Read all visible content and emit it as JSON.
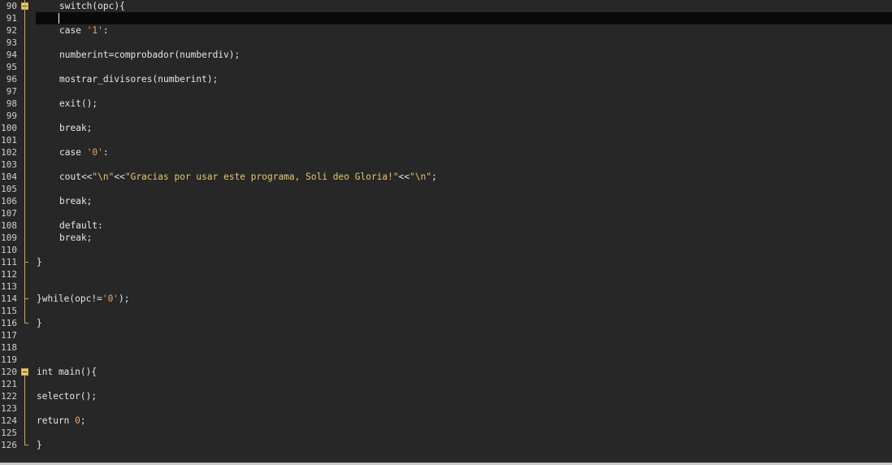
{
  "editor": {
    "lines": [
      {
        "n": "90",
        "indent": 2,
        "tokens": [
          [
            "plain",
            "switch(opc){"
          ]
        ]
      },
      {
        "n": "91",
        "indent": 2,
        "tokens": []
      },
      {
        "n": "92",
        "indent": 2,
        "tokens": [
          [
            "plain",
            "case "
          ],
          [
            "num",
            "'1'"
          ],
          [
            "plain",
            ":"
          ]
        ]
      },
      {
        "n": "93",
        "indent": 2,
        "tokens": []
      },
      {
        "n": "94",
        "indent": 2,
        "tokens": [
          [
            "plain",
            "numberint=comprobador(numberdiv);"
          ]
        ]
      },
      {
        "n": "95",
        "indent": 2,
        "tokens": []
      },
      {
        "n": "96",
        "indent": 2,
        "tokens": [
          [
            "plain",
            "mostrar_divisores(numberint);"
          ]
        ]
      },
      {
        "n": "97",
        "indent": 2,
        "tokens": []
      },
      {
        "n": "98",
        "indent": 2,
        "tokens": [
          [
            "plain",
            "exit();"
          ]
        ]
      },
      {
        "n": "99",
        "indent": 2,
        "tokens": []
      },
      {
        "n": "100",
        "indent": 2,
        "tokens": [
          [
            "plain",
            "break;"
          ]
        ]
      },
      {
        "n": "101",
        "indent": 2,
        "tokens": []
      },
      {
        "n": "102",
        "indent": 2,
        "tokens": [
          [
            "plain",
            "case "
          ],
          [
            "num",
            "'0'"
          ],
          [
            "plain",
            ":"
          ]
        ]
      },
      {
        "n": "103",
        "indent": 2,
        "tokens": []
      },
      {
        "n": "104",
        "indent": 2,
        "tokens": [
          [
            "plain",
            "cout<<"
          ],
          [
            "str",
            "\"\\n\""
          ],
          [
            "plain",
            "<<"
          ],
          [
            "str",
            "\"Gracias por usar este programa, Soli deo Gloria!\""
          ],
          [
            "plain",
            "<<"
          ],
          [
            "str",
            "\"\\n\""
          ],
          [
            "plain",
            ";"
          ]
        ]
      },
      {
        "n": "105",
        "indent": 2,
        "tokens": []
      },
      {
        "n": "106",
        "indent": 2,
        "tokens": [
          [
            "plain",
            "break;"
          ]
        ]
      },
      {
        "n": "107",
        "indent": 2,
        "tokens": []
      },
      {
        "n": "108",
        "indent": 2,
        "tokens": [
          [
            "plain",
            "default:"
          ]
        ]
      },
      {
        "n": "109",
        "indent": 2,
        "tokens": [
          [
            "plain",
            "break;"
          ]
        ]
      },
      {
        "n": "110",
        "indent": 2,
        "tokens": []
      },
      {
        "n": "111",
        "indent": 1,
        "tokens": [
          [
            "plain",
            "}"
          ]
        ]
      },
      {
        "n": "112",
        "indent": 1,
        "tokens": []
      },
      {
        "n": "113",
        "indent": 1,
        "tokens": []
      },
      {
        "n": "114",
        "indent": 1,
        "tokens": [
          [
            "plain",
            "}while(opc!="
          ],
          [
            "num",
            "'0'"
          ],
          [
            "plain",
            ");"
          ]
        ]
      },
      {
        "n": "115",
        "indent": 1,
        "tokens": []
      },
      {
        "n": "116",
        "indent": 1,
        "tokens": [
          [
            "plain",
            "}"
          ]
        ]
      },
      {
        "n": "117",
        "indent": 1,
        "tokens": []
      },
      {
        "n": "118",
        "indent": 1,
        "tokens": []
      },
      {
        "n": "119",
        "indent": 1,
        "tokens": []
      },
      {
        "n": "120",
        "indent": 1,
        "tokens": [
          [
            "plain",
            "int main(){"
          ]
        ]
      },
      {
        "n": "121",
        "indent": 1,
        "tokens": []
      },
      {
        "n": "122",
        "indent": 1,
        "tokens": [
          [
            "plain",
            "selector();"
          ]
        ]
      },
      {
        "n": "123",
        "indent": 1,
        "tokens": []
      },
      {
        "n": "124",
        "indent": 1,
        "tokens": [
          [
            "plain",
            "return "
          ],
          [
            "num",
            "0"
          ],
          [
            "plain",
            ";"
          ]
        ]
      },
      {
        "n": "125",
        "indent": 1,
        "tokens": []
      },
      {
        "n": "126",
        "indent": 1,
        "tokens": [
          [
            "plain",
            "}"
          ]
        ]
      }
    ],
    "current_line": "91",
    "colors": {
      "background": "#272727",
      "text": "#e6e6e6",
      "number_literal": "#e8a36a",
      "string_literal": "#e8c86a",
      "fold_marker": "#e6c872",
      "current_line_bg": "#0a0a0a"
    },
    "fold_markers": [
      {
        "line": "90",
        "icon": "fold-collapse-icon"
      },
      {
        "line": "120",
        "icon": "fold-collapse-icon"
      }
    ]
  }
}
